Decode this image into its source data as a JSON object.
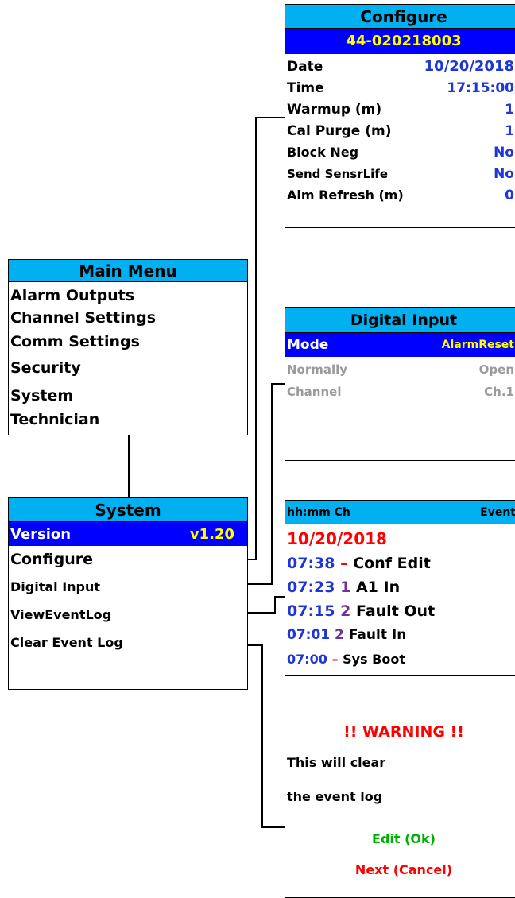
{
  "main_menu": {
    "title": "Main Menu",
    "items": [
      "Alarm Outputs",
      "Channel Settings",
      "Comm Settings",
      "Security",
      "System",
      "Technician"
    ]
  },
  "system_menu": {
    "title": "System",
    "selected": {
      "label": "Version",
      "value": "v1.20"
    },
    "items": [
      "Configure",
      "Digital Input",
      "ViewEventLog",
      "Clear Event Log"
    ]
  },
  "configure": {
    "title": "Configure",
    "serial": "44-020218003",
    "rows": [
      {
        "label": "Date",
        "value": "10/20/2018"
      },
      {
        "label": "Time",
        "value": "17:15:00"
      },
      {
        "label": "Warmup (m)",
        "value": "1"
      },
      {
        "label": "Cal Purge (m)",
        "value": "1"
      },
      {
        "label": "Block Neg",
        "value": "No"
      },
      {
        "label": "Send SensrLife",
        "value": "No"
      },
      {
        "label": "Alm Refresh (m)",
        "value": "0"
      }
    ]
  },
  "digital_input": {
    "title": "Digital Input",
    "selected": {
      "label": "Mode",
      "value": "AlarmReset"
    },
    "rows": [
      {
        "label": "Normally",
        "value": "Open"
      },
      {
        "label": "Channel",
        "value": "Ch.1"
      }
    ]
  },
  "event_log": {
    "header_left": "hh:mm Ch",
    "header_right": "Event",
    "date": "10/20/2018",
    "entries": [
      {
        "time": "07:38",
        "ch": "–",
        "event": "Conf Edit"
      },
      {
        "time": "07:23",
        "ch": "1",
        "event": "A1 In"
      },
      {
        "time": "07:15",
        "ch": "2",
        "event": "Fault Out"
      },
      {
        "time": "07:01",
        "ch": "2",
        "event": "Fault In"
      },
      {
        "time": "07:00",
        "ch": "–",
        "event": "Sys Boot"
      }
    ]
  },
  "warning": {
    "title": "!! WARNING !!",
    "line1": "This will clear",
    "line2": "the event log",
    "ok": "Edit (Ok)",
    "cancel": "Next (Cancel)"
  },
  "colors": {
    "header_bg": "#00b0f0",
    "selected_bg": "#0000ff",
    "selected_value": "#ffff00",
    "value_blue": "#1f36d6",
    "warning_red": "#ff0000",
    "ok_green": "#00b000",
    "channel_purple": "#7030a0",
    "disabled_gray": "#9a9a9a"
  }
}
